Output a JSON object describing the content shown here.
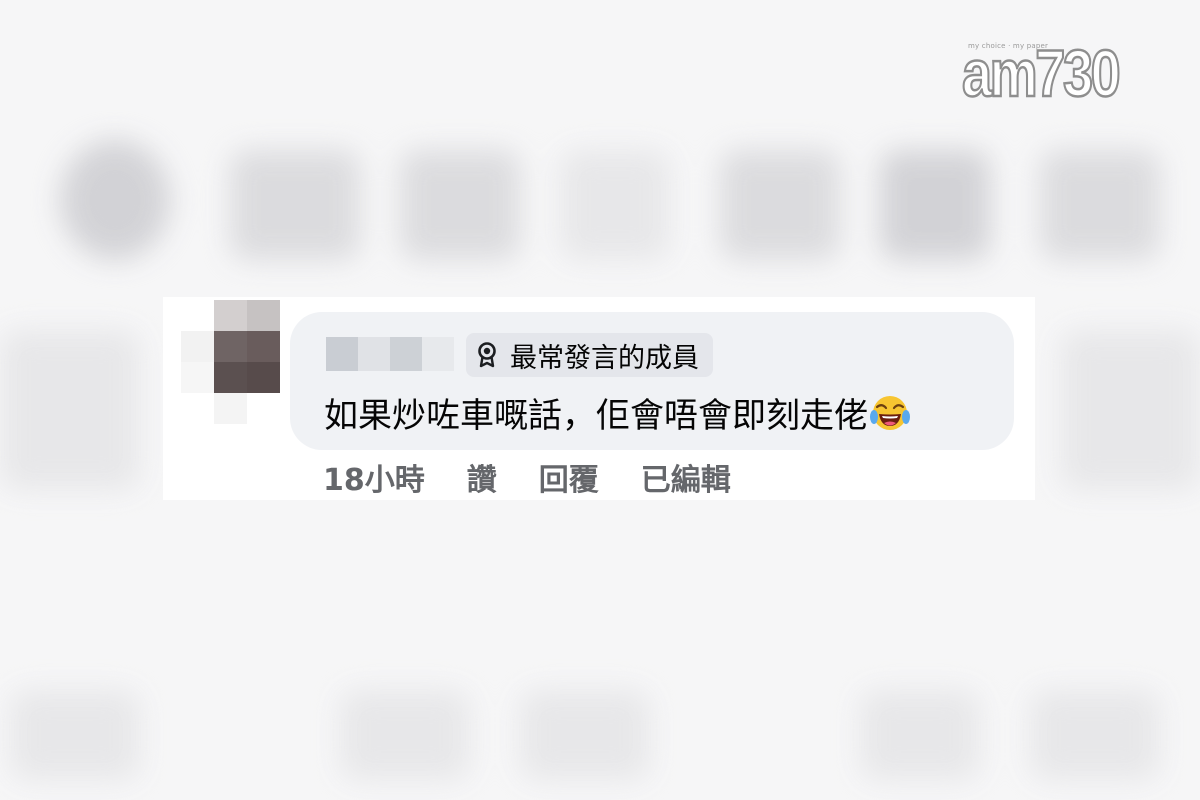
{
  "watermark": {
    "logo_text": "am730",
    "tagline": "my choice · my paper"
  },
  "comment": {
    "author_name_hidden": true,
    "badge": {
      "icon": "award-ribbon-icon",
      "label": "最常發言的成員"
    },
    "text": "如果炒咗車嘅話，佢會唔會即刻走佬",
    "emoji": "face-with-tears-of-joy-emoji",
    "actions": {
      "timestamp": "18小時",
      "like_label": "讚",
      "reply_label": "回覆",
      "edited_label": "已編輯"
    }
  },
  "colors": {
    "bubble_background": "#f0f2f5",
    "badge_background": "#e4e6eb",
    "text_primary": "#050505",
    "text_secondary": "#65676b"
  }
}
